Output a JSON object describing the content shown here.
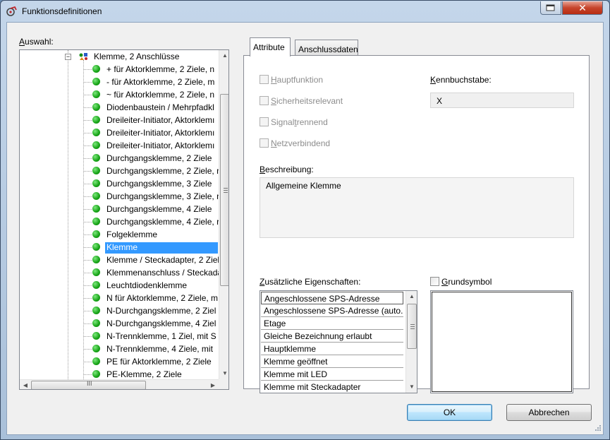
{
  "window": {
    "title": "Funktionsdefinitionen"
  },
  "left": {
    "label": "Auswahl:",
    "root": "Klemme, 2 Anschlüsse",
    "items": [
      "+ für Aktorklemme, 2 Ziele, n",
      "- für Aktorklemme, 2 Ziele, m",
      "~ für Aktorklemme, 2 Ziele, n",
      "Diodenbaustein / Mehrpfadkl",
      "Dreileiter-Initiator, Aktorklemı",
      "Dreileiter-Initiator, Aktorklemı",
      "Dreileiter-Initiator, Aktorklemı",
      "Durchgangsklemme, 2 Ziele",
      "Durchgangsklemme, 2 Ziele, n",
      "Durchgangsklemme, 3 Ziele",
      "Durchgangsklemme, 3 Ziele, n",
      "Durchgangsklemme, 4 Ziele",
      "Durchgangsklemme, 4 Ziele, r",
      "Folgeklemme",
      "Klemme",
      "Klemme / Steckadapter, 2 Ziel",
      "Klemmenanschluss / Steckada",
      "Leuchtdiodenklemme",
      "N für Aktorklemme, 2 Ziele, m",
      "N-Durchgangsklemme, 2 Ziel",
      "N-Durchgangsklemme, 4 Ziel",
      "N-Trennklemme, 1 Ziel, mit S",
      "N-Trennklemme, 4 Ziele, mit",
      "PE für Aktorklemme, 2 Ziele",
      "PE-Klemme, 2 Ziele"
    ],
    "selected_index": 14,
    "hscroll_grip": "III"
  },
  "tabs": [
    {
      "label": "Attribute",
      "active": true
    },
    {
      "label": "Anschlussdaten",
      "active": false
    }
  ],
  "attributes": {
    "checkboxes": [
      {
        "label": "Hauptfunktion",
        "checked": false,
        "enabled": false
      },
      {
        "label": "Sicherheitsrelevant",
        "checked": false,
        "enabled": false
      },
      {
        "label": "Signaltrennend",
        "checked": false,
        "enabled": false
      },
      {
        "label": "Netzverbindend",
        "checked": false,
        "enabled": false
      }
    ],
    "kennbuchstabe_label": "Kennbuchstabe:",
    "kennbuchstabe_value": "X",
    "beschreibung_label": "Beschreibung:",
    "beschreibung_value": "Allgemeine Klemme",
    "zusatz_label": "Zusätzliche Eigenschaften:",
    "zusatz_items": [
      "Angeschlossene SPS-Adresse",
      "Angeschlossene SPS-Adresse (auto...",
      "Etage",
      "Gleiche Bezeichnung erlaubt",
      "Hauptklemme",
      "Klemme geöffnet",
      "Klemme mit LED",
      "Klemme mit Steckadapter"
    ],
    "grundsymbol_label": "Grundsymbol",
    "grundsymbol_checked": false
  },
  "buttons": {
    "ok": "OK",
    "cancel": "Abbrechen"
  },
  "colors": {
    "selection": "#3399ff",
    "status_dot": "#16a316"
  }
}
